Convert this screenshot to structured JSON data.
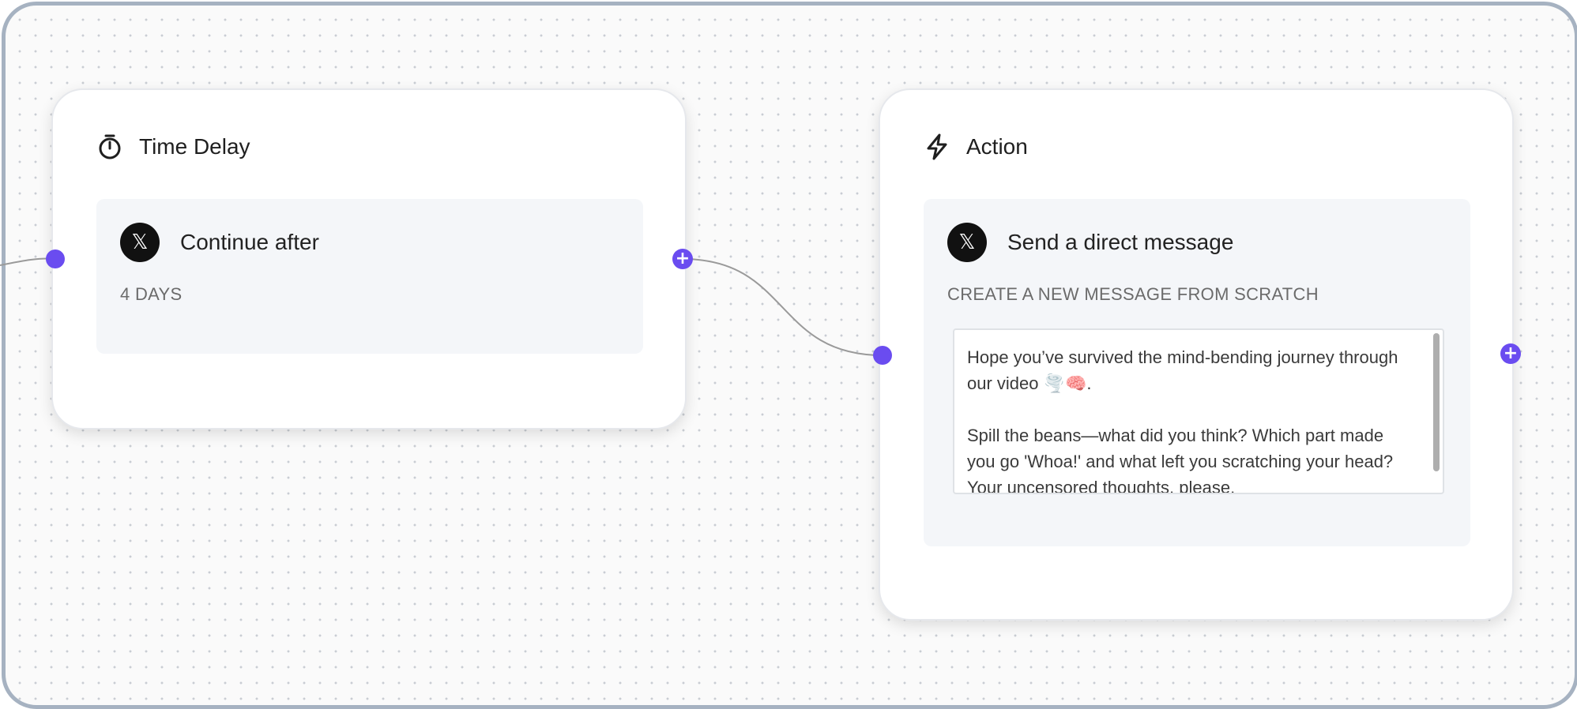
{
  "canvas": {
    "accent_color": "#6a4cf0",
    "frame_color": "#a6b2c1"
  },
  "time_delay_node": {
    "icon": "stopwatch-icon",
    "title": "Time Delay",
    "step": {
      "platform_icon": "x-logo-icon",
      "platform_glyph": "𝕏",
      "label": "Continue after",
      "value": "4 DAYS"
    },
    "output_handle": "+"
  },
  "action_node": {
    "icon": "lightning-icon",
    "title": "Action",
    "step": {
      "platform_icon": "x-logo-icon",
      "platform_glyph": "𝕏",
      "label": "Send a direct message",
      "mode": "CREATE A NEW MESSAGE FROM SCRATCH",
      "message_paragraph_1": "Hope you’ve survived the mind-bending journey through our video 🌪️🧠.",
      "message_paragraph_2": "Spill the beans—what did you think? Which part made you go 'Whoa!' and what left you scratching your head? Your uncensored thoughts, please."
    },
    "output_handle": "+"
  }
}
